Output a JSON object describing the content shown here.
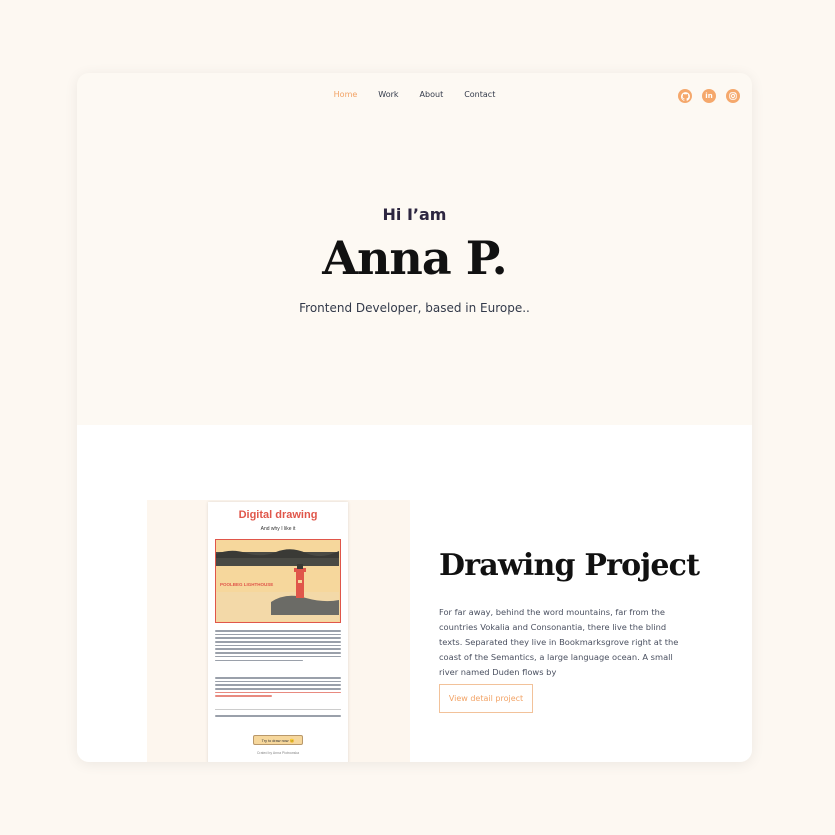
{
  "nav": {
    "links": [
      {
        "label": "Home",
        "active": true
      },
      {
        "label": "Work",
        "active": false
      },
      {
        "label": "About",
        "active": false
      },
      {
        "label": "Contact",
        "active": false
      }
    ],
    "socials": [
      "github-icon",
      "linkedin-icon",
      "instagram-icon"
    ]
  },
  "hero": {
    "greeting": "Hi I’am",
    "name": "Anna P.",
    "subtitle": "Frontend Developer, based in Europe.."
  },
  "project": {
    "title": "Drawing Project",
    "description": "For far away, behind the word mountains, far from the countries Vokalia and Consonantia, there live the blind texts. Separated they live in Bookmarksgrove right at the coast of the Semantics, a large language ocean. A small river named Duden flows by",
    "button_label": "View detail project",
    "preview": {
      "title": "Digital drawing",
      "subtitle": "And why I like it",
      "art_label": "POOLBEG LIGHTHOUSE",
      "button_label": "Try to draw now 😊",
      "footer": "Crated by Anna Piotrowska"
    }
  },
  "colors": {
    "accent": "#f2a366",
    "page_bg": "#fdf8f2",
    "drawing_red": "#e0564a"
  }
}
